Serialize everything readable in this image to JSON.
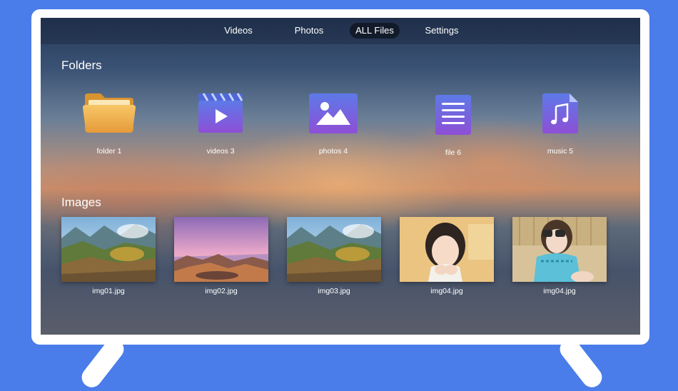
{
  "nav": {
    "tabs": [
      {
        "label": "Videos",
        "active": false
      },
      {
        "label": "Photos",
        "active": false
      },
      {
        "label": "ALL Files",
        "active": true
      },
      {
        "label": "Settings",
        "active": false
      }
    ]
  },
  "folders": {
    "title": "Folders",
    "items": [
      {
        "label": "folder 1",
        "icon": "folder-icon"
      },
      {
        "label": "videos 3",
        "icon": "video-icon"
      },
      {
        "label": "photos 4",
        "icon": "photo-icon"
      },
      {
        "label": "file 6",
        "icon": "document-icon"
      },
      {
        "label": "music 5",
        "icon": "music-icon"
      }
    ]
  },
  "images": {
    "title": "Images",
    "items": [
      {
        "label": "img01.jpg",
        "subject": "mountain valley"
      },
      {
        "label": "img02.jpg",
        "subject": "rocky seashore at sunset"
      },
      {
        "label": "img03.jpg",
        "subject": "mountain valley"
      },
      {
        "label": "img04.jpg",
        "subject": "portrait girl"
      },
      {
        "label": "img04.jpg",
        "subject": "girl with binoculars"
      }
    ]
  },
  "colors": {
    "background": "#4a7dea",
    "frame": "#ffffff",
    "folder": "#f2b24c",
    "icon_tile_top": "#5d7ae8",
    "icon_tile_bottom": "#8e4fd6"
  }
}
